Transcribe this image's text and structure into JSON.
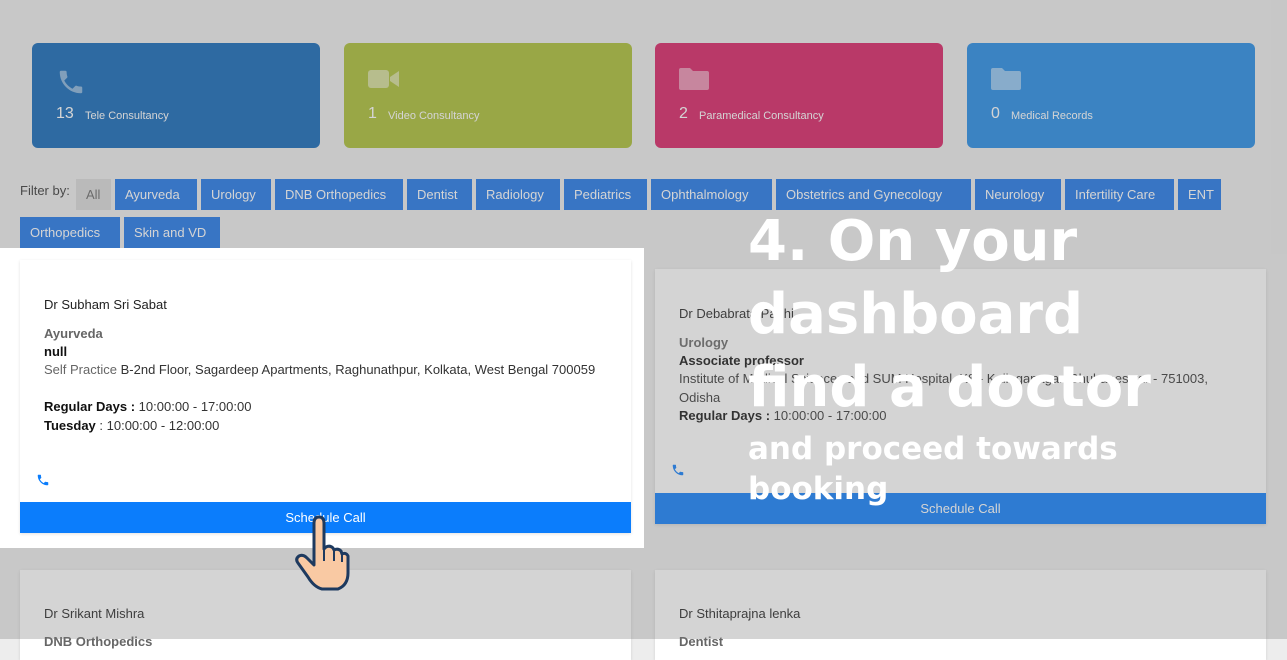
{
  "stats": [
    {
      "count": "13",
      "label": "Tele Consultancy",
      "icon": "phone-icon",
      "color": "#0b63b6"
    },
    {
      "count": "1",
      "label": "Video Consultancy",
      "icon": "video-icon",
      "color": "#a9bd2e"
    },
    {
      "count": "2",
      "label": "Paramedical Consultancy",
      "icon": "folder-icon",
      "color": "#d81b60"
    },
    {
      "count": "0",
      "label": "Medical Records",
      "icon": "folder-icon",
      "color": "#1e88e5"
    }
  ],
  "filter": {
    "label": "Filter by:",
    "chips": [
      "All",
      "Ayurveda",
      "Urology",
      "DNB Orthopedics",
      "Dentist",
      "Radiology",
      "Pediatrics",
      "Ophthalmology",
      "Obstetrics and Gynecology",
      "Neurology",
      "Infertility Care",
      "ENT",
      "Orthopedics",
      "Skin and VD"
    ]
  },
  "doctors": [
    {
      "name": "Dr Subham Sri Sabat",
      "speciality": "Ayurveda",
      "designation": "null",
      "address_label": "Self Practice",
      "address": "B-2nd Floor, Sagardeep Apartments, Raghunathpur, Kolkata, West Bengal 700059",
      "regular_label": "Regular Days :",
      "regular_time": "10:00:00 - 17:00:00",
      "tuesday_label": "Tuesday",
      "tuesday_time": ": 10:00:00 - 12:00:00",
      "button": "Schedule Call"
    },
    {
      "name": "Dr Debabrata Padhi",
      "speciality": "Urology",
      "designation": "Associate professor",
      "address": "Institute of Medical Sciences and SUM Hospital, K8 - Kalinganagar, Bhubaneswar - 751003, Odisha",
      "regular_label": "Regular Days :",
      "regular_time": "10:00:00 - 17:00:00",
      "button": "Schedule Call"
    },
    {
      "name": "Dr Srikant Mishra",
      "speciality": "DNB Orthopedics"
    },
    {
      "name": "Dr Sthitaprajna lenka",
      "speciality": "Dentist"
    }
  ],
  "caption": {
    "line1": "4. On your",
    "line2": "dashboard",
    "line3": "find a doctor",
    "line4": "and proceed towards",
    "line5": "booking"
  },
  "colors": {
    "accent": "#0b7dfc",
    "chip": "#1a73e8"
  }
}
